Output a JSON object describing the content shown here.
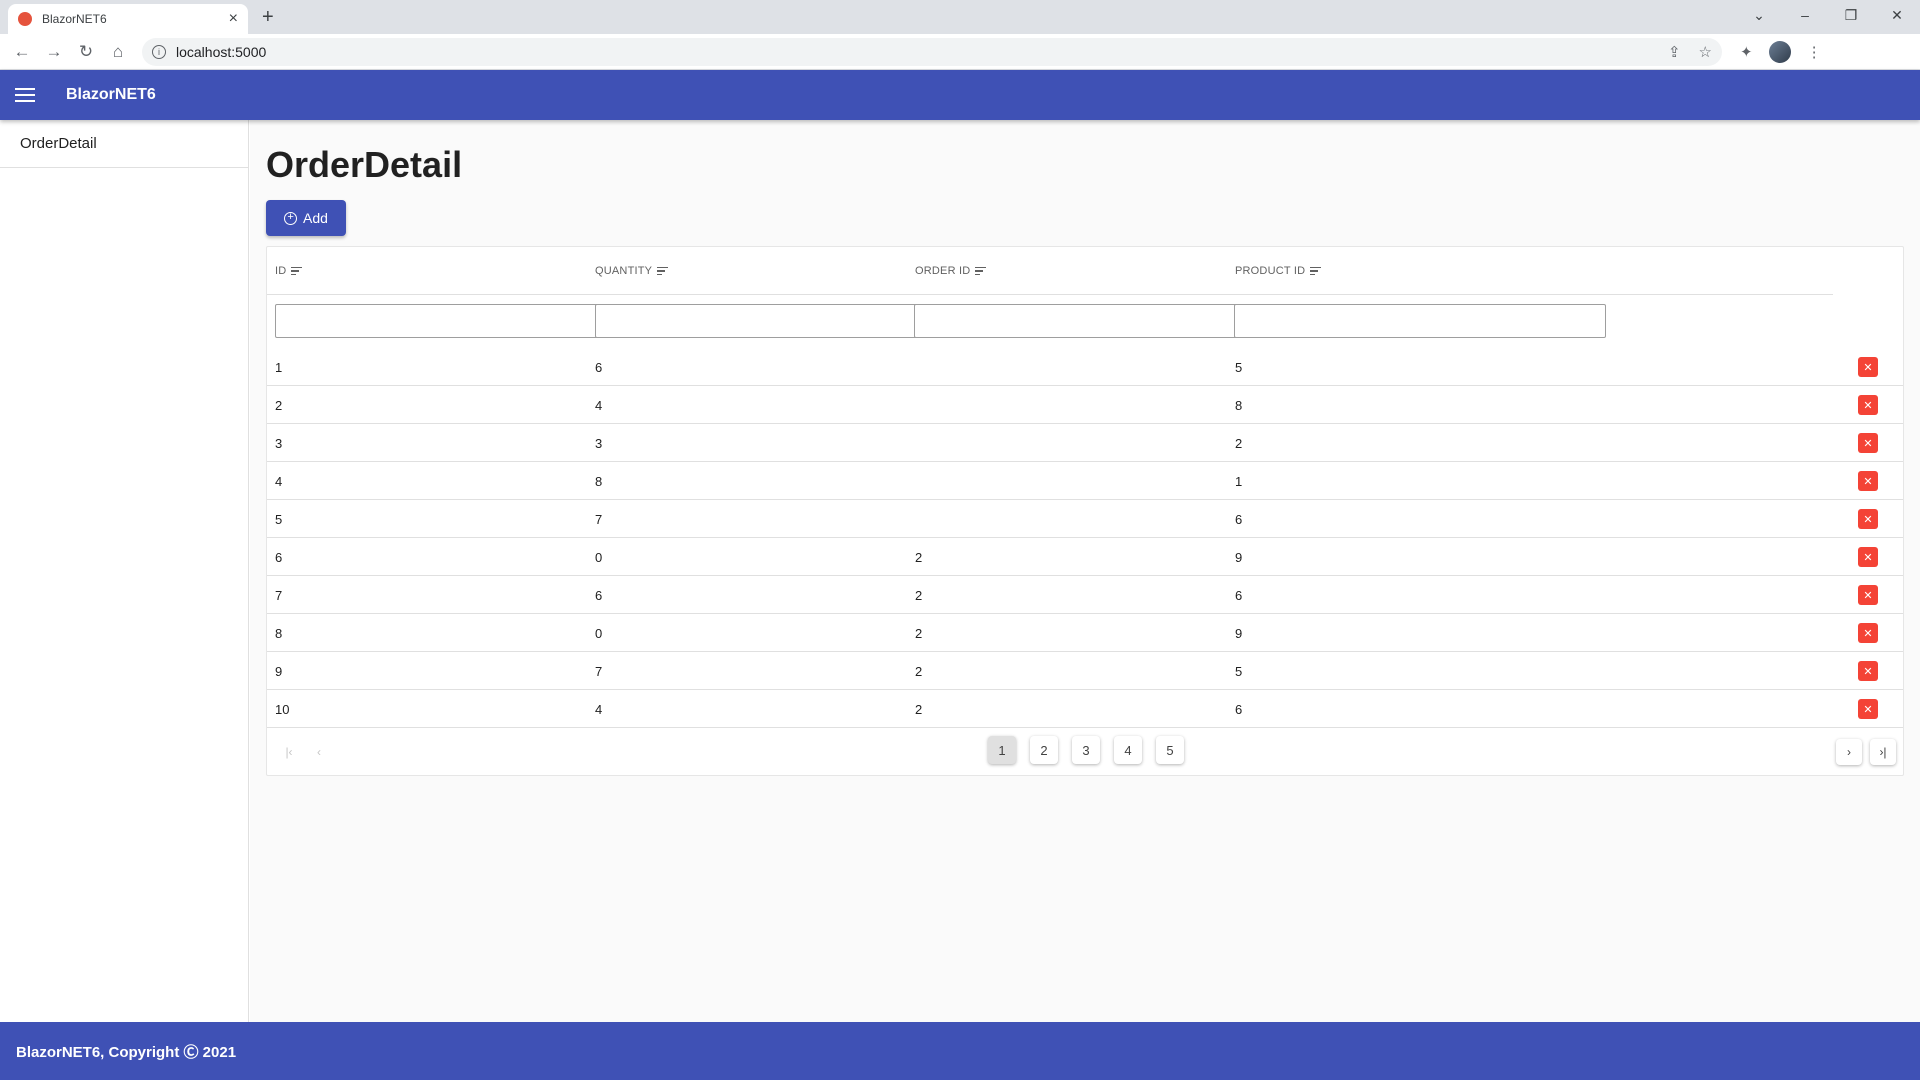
{
  "browser": {
    "tab_title": "BlazorNET6",
    "tab_close": "×",
    "new_tab": "+",
    "url": "localhost:5000",
    "window_controls": [
      "⌄",
      "–",
      "❐",
      "✕"
    ]
  },
  "app": {
    "title": "BlazorNET6"
  },
  "sidebar": {
    "items": [
      {
        "label": "OrderDetail"
      }
    ]
  },
  "page": {
    "title": "OrderDetail",
    "add_label": "Add"
  },
  "grid": {
    "columns": [
      "ID",
      "QUANTITY",
      "ORDER ID",
      "PRODUCT ID"
    ],
    "rows": [
      {
        "id": "1",
        "quantity": "6",
        "order_id": "",
        "product_id": "5"
      },
      {
        "id": "2",
        "quantity": "4",
        "order_id": "",
        "product_id": "8"
      },
      {
        "id": "3",
        "quantity": "3",
        "order_id": "",
        "product_id": "2"
      },
      {
        "id": "4",
        "quantity": "8",
        "order_id": "",
        "product_id": "1"
      },
      {
        "id": "5",
        "quantity": "7",
        "order_id": "",
        "product_id": "6"
      },
      {
        "id": "6",
        "quantity": "0",
        "order_id": "2",
        "product_id": "9"
      },
      {
        "id": "7",
        "quantity": "6",
        "order_id": "2",
        "product_id": "6"
      },
      {
        "id": "8",
        "quantity": "0",
        "order_id": "2",
        "product_id": "9"
      },
      {
        "id": "9",
        "quantity": "7",
        "order_id": "2",
        "product_id": "5"
      },
      {
        "id": "10",
        "quantity": "4",
        "order_id": "2",
        "product_id": "6"
      }
    ],
    "delete_symbol": "✕"
  },
  "pager": {
    "pages": [
      "1",
      "2",
      "3",
      "4",
      "5"
    ],
    "current": "1",
    "first": "|‹",
    "prev": "‹",
    "next": "›",
    "last": "›|"
  },
  "footer": {
    "text": "BlazorNET6, Copyright Ⓒ 2021"
  },
  "colors": {
    "primary": "#3f51b5",
    "danger": "#f44336"
  }
}
